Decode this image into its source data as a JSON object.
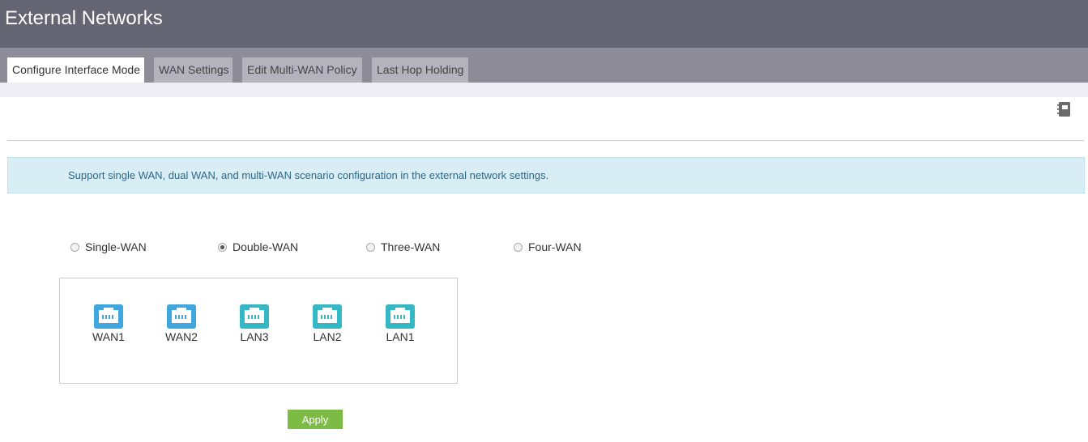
{
  "header": {
    "title": "External Networks"
  },
  "tabs": [
    {
      "label": "Configure Interface Mode",
      "active": true
    },
    {
      "label": "WAN Settings",
      "active": false
    },
    {
      "label": "Edit Multi-WAN Policy",
      "active": false
    },
    {
      "label": "Last Hop Holding",
      "active": false
    }
  ],
  "toolbar": {
    "icon": "notebook-icon"
  },
  "info": {
    "text": "Support single WAN, dual WAN, and multi-WAN scenario configuration in the external network settings."
  },
  "modes": [
    {
      "label": "Single-WAN",
      "selected": false
    },
    {
      "label": "Double-WAN",
      "selected": true
    },
    {
      "label": "Three-WAN",
      "selected": false
    },
    {
      "label": "Four-WAN",
      "selected": false
    }
  ],
  "ports": [
    {
      "label": "WAN1",
      "type": "wan",
      "color": "#3fa6e0",
      "icon": "ethernet-port-icon"
    },
    {
      "label": "WAN2",
      "type": "wan",
      "color": "#3fa6e0",
      "icon": "ethernet-port-icon"
    },
    {
      "label": "LAN3",
      "type": "lan",
      "color": "#35b8c3",
      "icon": "ethernet-port-icon"
    },
    {
      "label": "LAN2",
      "type": "lan",
      "color": "#35b8c3",
      "icon": "ethernet-port-icon"
    },
    {
      "label": "LAN1",
      "type": "lan",
      "color": "#35b8c3",
      "icon": "ethernet-port-icon"
    }
  ],
  "apply": {
    "label": "Apply",
    "color": "#7cbb44"
  }
}
